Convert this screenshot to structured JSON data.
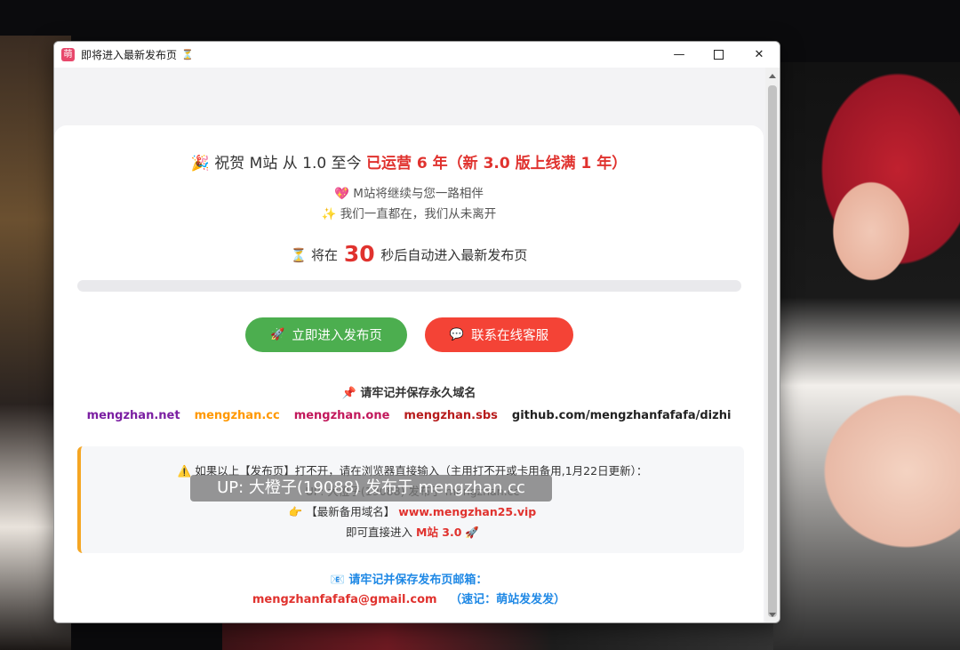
{
  "window": {
    "title": "即将进入最新发布页",
    "title_icon": "萌",
    "title_suffix_icon": "⏳",
    "minimize_glyph": "—",
    "close_glyph": "✕"
  },
  "headline": {
    "icon": "🎉",
    "text_before": "祝贺 M站 从 1.0 至今",
    "text_highlight": "已运营 6 年（新 3.0 版上线满 1 年）"
  },
  "subtitles": [
    {
      "icon": "💖",
      "text": "M站将继续与您一路相伴"
    },
    {
      "icon": "✨",
      "text": "我们一直都在，我们从未离开"
    }
  ],
  "countdown": {
    "icon": "⏳",
    "prefix": "将在",
    "seconds": "30",
    "suffix": "秒后自动进入最新发布页",
    "progress": 0
  },
  "buttons": {
    "enter": {
      "icon": "🚀",
      "label": "立即进入发布页"
    },
    "support": {
      "icon": "💬",
      "label": "联系在线客服"
    }
  },
  "domains": {
    "title_icon": "📌",
    "title": "请牢记并保存永久域名",
    "list": [
      "mengzhan.net",
      "mengzhan.cc",
      "mengzhan.one",
      "mengzhan.sbs",
      "github.com/mengzhanfafafa/dizhi"
    ]
  },
  "notice": {
    "warn_icon": "⚠️",
    "line1": "如果以上【发布页】打不开，请在浏览器直接输入（主用打不开或卡用备用,1月22日更新）：",
    "line2": "UP: 大橙子(19088) 发布于 mengzhan.cc",
    "line3_icon": "👉",
    "line3_label": "【最新备用域名】",
    "line3_domain": "www.mengzhan25.vip",
    "line4_text": "即可直接进入",
    "line4_highlight": "M站 3.0",
    "line4_icon": "🚀"
  },
  "email": {
    "icon": "📧",
    "title": "请牢记并保存发布页邮箱：",
    "address": "mengzhanfafafa@gmail.com",
    "tip": "（速记：萌站发发发）"
  },
  "watermark": "UP: 大橙子(19088) 发布于 mengzhan.cc"
}
